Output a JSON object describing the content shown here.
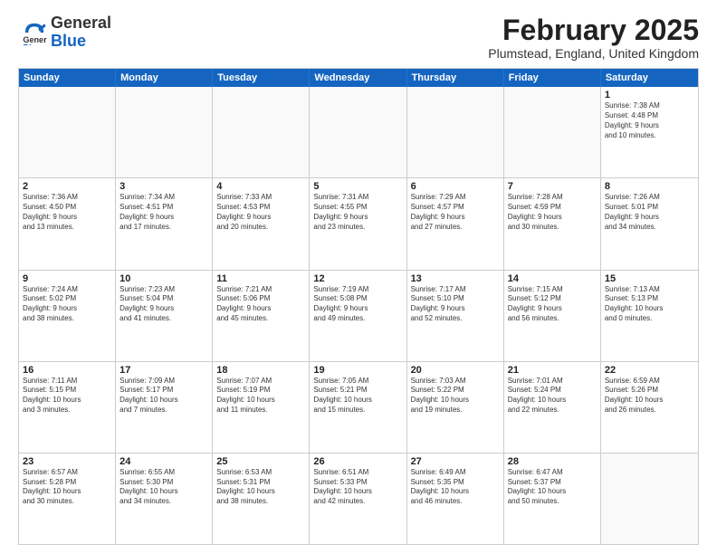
{
  "logo": {
    "general": "General",
    "blue": "Blue"
  },
  "title": "February 2025",
  "subtitle": "Plumstead, England, United Kingdom",
  "days_of_week": [
    "Sunday",
    "Monday",
    "Tuesday",
    "Wednesday",
    "Thursday",
    "Friday",
    "Saturday"
  ],
  "weeks": [
    [
      {
        "day": "",
        "info": ""
      },
      {
        "day": "",
        "info": ""
      },
      {
        "day": "",
        "info": ""
      },
      {
        "day": "",
        "info": ""
      },
      {
        "day": "",
        "info": ""
      },
      {
        "day": "",
        "info": ""
      },
      {
        "day": "1",
        "info": "Sunrise: 7:38 AM\nSunset: 4:48 PM\nDaylight: 9 hours\nand 10 minutes."
      }
    ],
    [
      {
        "day": "2",
        "info": "Sunrise: 7:36 AM\nSunset: 4:50 PM\nDaylight: 9 hours\nand 13 minutes."
      },
      {
        "day": "3",
        "info": "Sunrise: 7:34 AM\nSunset: 4:51 PM\nDaylight: 9 hours\nand 17 minutes."
      },
      {
        "day": "4",
        "info": "Sunrise: 7:33 AM\nSunset: 4:53 PM\nDaylight: 9 hours\nand 20 minutes."
      },
      {
        "day": "5",
        "info": "Sunrise: 7:31 AM\nSunset: 4:55 PM\nDaylight: 9 hours\nand 23 minutes."
      },
      {
        "day": "6",
        "info": "Sunrise: 7:29 AM\nSunset: 4:57 PM\nDaylight: 9 hours\nand 27 minutes."
      },
      {
        "day": "7",
        "info": "Sunrise: 7:28 AM\nSunset: 4:59 PM\nDaylight: 9 hours\nand 30 minutes."
      },
      {
        "day": "8",
        "info": "Sunrise: 7:26 AM\nSunset: 5:01 PM\nDaylight: 9 hours\nand 34 minutes."
      }
    ],
    [
      {
        "day": "9",
        "info": "Sunrise: 7:24 AM\nSunset: 5:02 PM\nDaylight: 9 hours\nand 38 minutes."
      },
      {
        "day": "10",
        "info": "Sunrise: 7:23 AM\nSunset: 5:04 PM\nDaylight: 9 hours\nand 41 minutes."
      },
      {
        "day": "11",
        "info": "Sunrise: 7:21 AM\nSunset: 5:06 PM\nDaylight: 9 hours\nand 45 minutes."
      },
      {
        "day": "12",
        "info": "Sunrise: 7:19 AM\nSunset: 5:08 PM\nDaylight: 9 hours\nand 49 minutes."
      },
      {
        "day": "13",
        "info": "Sunrise: 7:17 AM\nSunset: 5:10 PM\nDaylight: 9 hours\nand 52 minutes."
      },
      {
        "day": "14",
        "info": "Sunrise: 7:15 AM\nSunset: 5:12 PM\nDaylight: 9 hours\nand 56 minutes."
      },
      {
        "day": "15",
        "info": "Sunrise: 7:13 AM\nSunset: 5:13 PM\nDaylight: 10 hours\nand 0 minutes."
      }
    ],
    [
      {
        "day": "16",
        "info": "Sunrise: 7:11 AM\nSunset: 5:15 PM\nDaylight: 10 hours\nand 3 minutes."
      },
      {
        "day": "17",
        "info": "Sunrise: 7:09 AM\nSunset: 5:17 PM\nDaylight: 10 hours\nand 7 minutes."
      },
      {
        "day": "18",
        "info": "Sunrise: 7:07 AM\nSunset: 5:19 PM\nDaylight: 10 hours\nand 11 minutes."
      },
      {
        "day": "19",
        "info": "Sunrise: 7:05 AM\nSunset: 5:21 PM\nDaylight: 10 hours\nand 15 minutes."
      },
      {
        "day": "20",
        "info": "Sunrise: 7:03 AM\nSunset: 5:22 PM\nDaylight: 10 hours\nand 19 minutes."
      },
      {
        "day": "21",
        "info": "Sunrise: 7:01 AM\nSunset: 5:24 PM\nDaylight: 10 hours\nand 22 minutes."
      },
      {
        "day": "22",
        "info": "Sunrise: 6:59 AM\nSunset: 5:26 PM\nDaylight: 10 hours\nand 26 minutes."
      }
    ],
    [
      {
        "day": "23",
        "info": "Sunrise: 6:57 AM\nSunset: 5:28 PM\nDaylight: 10 hours\nand 30 minutes."
      },
      {
        "day": "24",
        "info": "Sunrise: 6:55 AM\nSunset: 5:30 PM\nDaylight: 10 hours\nand 34 minutes."
      },
      {
        "day": "25",
        "info": "Sunrise: 6:53 AM\nSunset: 5:31 PM\nDaylight: 10 hours\nand 38 minutes."
      },
      {
        "day": "26",
        "info": "Sunrise: 6:51 AM\nSunset: 5:33 PM\nDaylight: 10 hours\nand 42 minutes."
      },
      {
        "day": "27",
        "info": "Sunrise: 6:49 AM\nSunset: 5:35 PM\nDaylight: 10 hours\nand 46 minutes."
      },
      {
        "day": "28",
        "info": "Sunrise: 6:47 AM\nSunset: 5:37 PM\nDaylight: 10 hours\nand 50 minutes."
      },
      {
        "day": "",
        "info": ""
      }
    ]
  ]
}
